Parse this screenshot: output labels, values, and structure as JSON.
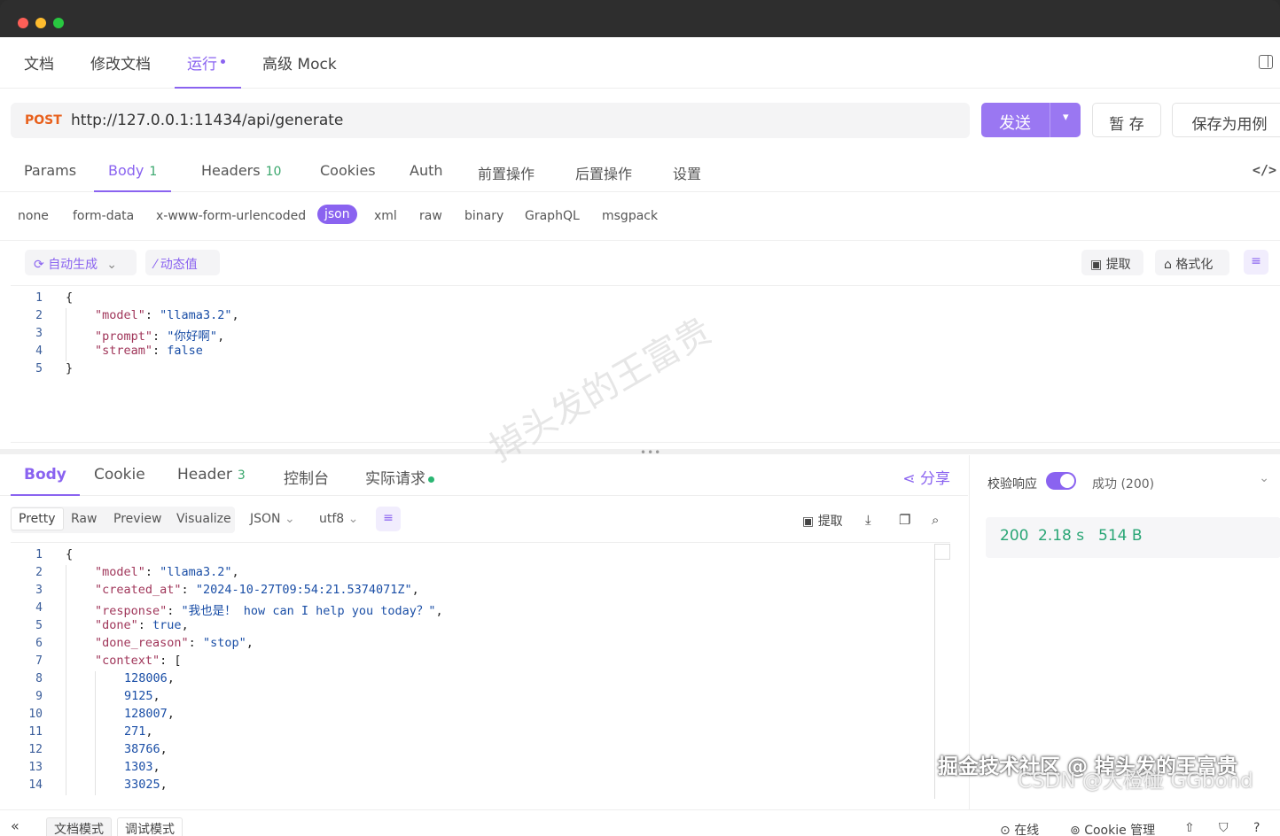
{
  "window": {
    "dots": [
      "#fe5f57",
      "#febc2e",
      "#28c840"
    ]
  },
  "top_tabs": [
    {
      "label": "文档"
    },
    {
      "label": "修改文档"
    },
    {
      "label": "运行"
    },
    {
      "label": "高级 Mock"
    }
  ],
  "request": {
    "method": "POST",
    "url": "http://127.0.0.1:11434/api/generate",
    "send_label": "发送",
    "save_label": "暂 存",
    "save_case_label": "保存为用例"
  },
  "req_tabs": [
    {
      "label": "Params",
      "count": ""
    },
    {
      "label": "Body",
      "count": "1"
    },
    {
      "label": "Headers",
      "count": "10"
    },
    {
      "label": "Cookies",
      "count": ""
    },
    {
      "label": "Auth",
      "count": ""
    },
    {
      "label": "前置操作",
      "count": ""
    },
    {
      "label": "后置操作",
      "count": ""
    },
    {
      "label": "设置",
      "count": ""
    }
  ],
  "code_icon": "</>",
  "body_types": [
    "none",
    "form-data",
    "x-www-form-urlencoded",
    "json",
    "xml",
    "raw",
    "binary",
    "GraphQL",
    "msgpack"
  ],
  "body_tools": {
    "auto_gen": "自动生成",
    "dynamic": "动态值",
    "extract": "提取",
    "format": "格式化"
  },
  "request_body_lines": [
    {
      "n": "1",
      "indent": 0,
      "parts": [
        {
          "t": "{",
          "c": "punc"
        }
      ]
    },
    {
      "n": "2",
      "indent": 1,
      "parts": [
        {
          "t": "\"model\"",
          "c": "key"
        },
        {
          "t": ": ",
          "c": "punc"
        },
        {
          "t": "\"llama3.2\"",
          "c": "str"
        },
        {
          "t": ",",
          "c": "punc"
        }
      ]
    },
    {
      "n": "3",
      "indent": 1,
      "parts": [
        {
          "t": "\"prompt\"",
          "c": "key"
        },
        {
          "t": ": ",
          "c": "punc"
        },
        {
          "t": "\"你好啊\"",
          "c": "str"
        },
        {
          "t": ",",
          "c": "punc"
        }
      ]
    },
    {
      "n": "4",
      "indent": 1,
      "parts": [
        {
          "t": "\"stream\"",
          "c": "key"
        },
        {
          "t": ": ",
          "c": "punc"
        },
        {
          "t": "false",
          "c": "kw"
        }
      ]
    },
    {
      "n": "5",
      "indent": 0,
      "parts": [
        {
          "t": "}",
          "c": "punc"
        }
      ]
    }
  ],
  "resp_tabs": [
    {
      "label": "Body",
      "count": ""
    },
    {
      "label": "Cookie",
      "count": ""
    },
    {
      "label": "Header",
      "count": "3"
    },
    {
      "label": "控制台",
      "count": ""
    },
    {
      "label": "实际请求",
      "count": ""
    }
  ],
  "share_label": "分享",
  "resp_formats": [
    "Pretty",
    "Raw",
    "Preview",
    "Visualize"
  ],
  "resp_selects": {
    "type": "JSON",
    "encoding": "utf8"
  },
  "resp_tools": {
    "extract": "提取"
  },
  "response_body_lines": [
    {
      "n": "1",
      "indent": 0,
      "parts": [
        {
          "t": "{",
          "c": "punc"
        }
      ]
    },
    {
      "n": "2",
      "indent": 1,
      "parts": [
        {
          "t": "\"model\"",
          "c": "key"
        },
        {
          "t": ": ",
          "c": "punc"
        },
        {
          "t": "\"llama3.2\"",
          "c": "str"
        },
        {
          "t": ",",
          "c": "punc"
        }
      ]
    },
    {
      "n": "3",
      "indent": 1,
      "parts": [
        {
          "t": "\"created_at\"",
          "c": "key"
        },
        {
          "t": ": ",
          "c": "punc"
        },
        {
          "t": "\"2024-10-27T09:54:21.5374071Z\"",
          "c": "str"
        },
        {
          "t": ",",
          "c": "punc"
        }
      ]
    },
    {
      "n": "4",
      "indent": 1,
      "parts": [
        {
          "t": "\"response\"",
          "c": "key"
        },
        {
          "t": ": ",
          "c": "punc"
        },
        {
          "t": "\"我也是！ how can I help you today？\"",
          "c": "str"
        },
        {
          "t": ",",
          "c": "punc"
        }
      ]
    },
    {
      "n": "5",
      "indent": 1,
      "parts": [
        {
          "t": "\"done\"",
          "c": "key"
        },
        {
          "t": ": ",
          "c": "punc"
        },
        {
          "t": "true",
          "c": "kw"
        },
        {
          "t": ",",
          "c": "punc"
        }
      ]
    },
    {
      "n": "6",
      "indent": 1,
      "parts": [
        {
          "t": "\"done_reason\"",
          "c": "key"
        },
        {
          "t": ": ",
          "c": "punc"
        },
        {
          "t": "\"stop\"",
          "c": "str"
        },
        {
          "t": ",",
          "c": "punc"
        }
      ]
    },
    {
      "n": "7",
      "indent": 1,
      "parts": [
        {
          "t": "\"context\"",
          "c": "key"
        },
        {
          "t": ": [",
          "c": "punc"
        }
      ]
    },
    {
      "n": "8",
      "indent": 2,
      "parts": [
        {
          "t": "128006",
          "c": "num"
        },
        {
          "t": ",",
          "c": "punc"
        }
      ]
    },
    {
      "n": "9",
      "indent": 2,
      "parts": [
        {
          "t": "9125",
          "c": "num"
        },
        {
          "t": ",",
          "c": "punc"
        }
      ]
    },
    {
      "n": "10",
      "indent": 2,
      "parts": [
        {
          "t": "128007",
          "c": "num"
        },
        {
          "t": ",",
          "c": "punc"
        }
      ]
    },
    {
      "n": "11",
      "indent": 2,
      "parts": [
        {
          "t": "271",
          "c": "num"
        },
        {
          "t": ",",
          "c": "punc"
        }
      ]
    },
    {
      "n": "12",
      "indent": 2,
      "parts": [
        {
          "t": "38766",
          "c": "num"
        },
        {
          "t": ",",
          "c": "punc"
        }
      ]
    },
    {
      "n": "13",
      "indent": 2,
      "parts": [
        {
          "t": "1303",
          "c": "num"
        },
        {
          "t": ",",
          "c": "punc"
        }
      ]
    },
    {
      "n": "14",
      "indent": 2,
      "parts": [
        {
          "t": "33025",
          "c": "num"
        },
        {
          "t": ",",
          "c": "punc"
        }
      ]
    }
  ],
  "side": {
    "verify_label": "校验响应",
    "status_select": "成功 (200)",
    "status_code": "200",
    "time": "2.18 s",
    "size": "514 B"
  },
  "footer": {
    "doc_mode": "文档模式",
    "debug_mode": "调试模式",
    "online": "在线",
    "cookie_mgr": "Cookie 管理"
  },
  "watermarks": {
    "diagonal": "掉头发的王富贵",
    "juejin": "掘金技术社区 @ 掉头发的王富贵",
    "csdn": "CSDN @大橙碰 GGbond"
  }
}
